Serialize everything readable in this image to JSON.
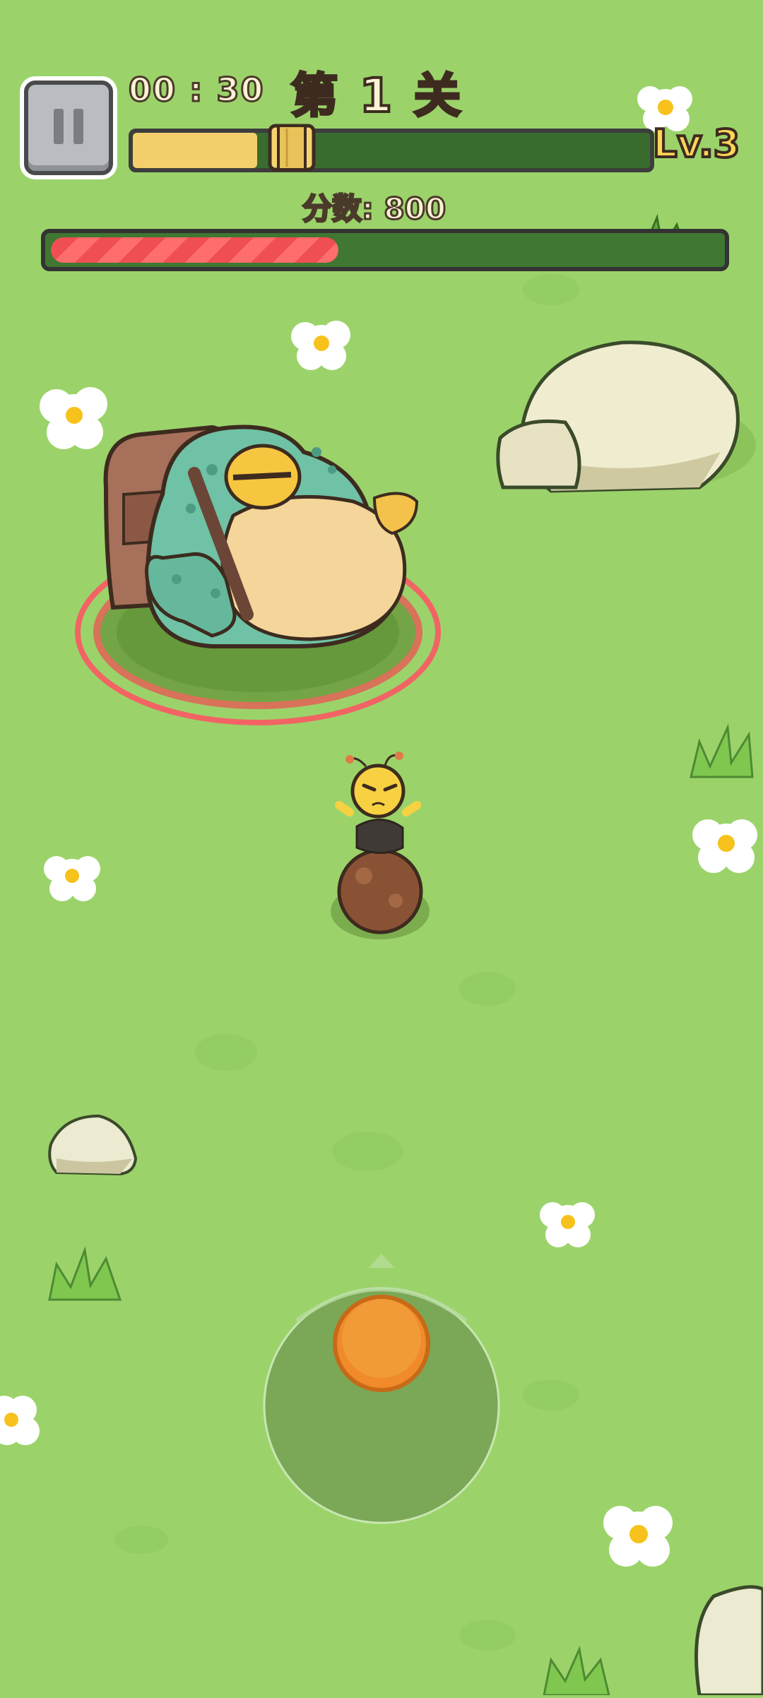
{
  "hud": {
    "timer": "00 : 30",
    "stage": "第 1 关",
    "level": "Lv.3",
    "score": "分数: 800",
    "xp_progress": 0.24,
    "boss_hp": 0.44
  },
  "colors": {
    "grass": "#9bd36a",
    "hp_fill": "#ff5a5a",
    "xp_fill": "#f3d06b",
    "joystick_knob": "#f08a2a"
  },
  "icons": [
    "pause-icon",
    "xp-scroll-icon",
    "flower-icon",
    "rock-icon",
    "grass-tuft-icon"
  ]
}
